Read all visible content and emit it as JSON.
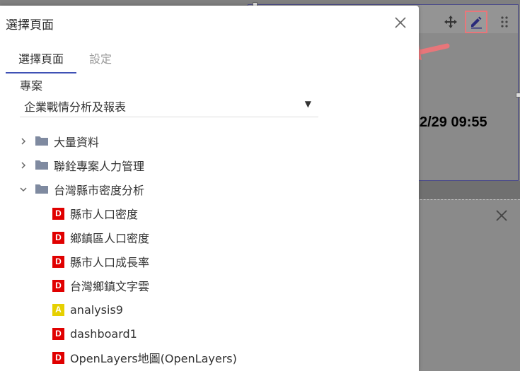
{
  "background": {
    "time_text": "2/29 09:55"
  },
  "dialog": {
    "title": "選擇頁面",
    "tabs": [
      {
        "label": "選擇頁面",
        "active": true
      },
      {
        "label": "設定",
        "active": false
      }
    ],
    "project_label": "專案",
    "project_value": "企業戰情分析及報表",
    "tree": [
      {
        "type": "folder",
        "label": "大量資料",
        "expanded": false
      },
      {
        "type": "folder",
        "label": "聯銓專案人力管理",
        "expanded": false
      },
      {
        "type": "folder",
        "label": "台灣縣市密度分析",
        "expanded": true
      },
      {
        "type": "page",
        "badge": "D",
        "label": "縣市人口密度"
      },
      {
        "type": "page",
        "badge": "D",
        "label": "鄉鎮區人口密度"
      },
      {
        "type": "page",
        "badge": "D",
        "label": "縣市人口成長率"
      },
      {
        "type": "page",
        "badge": "D",
        "label": "台灣鄉鎮文字雲"
      },
      {
        "type": "page",
        "badge": "A",
        "label": "analysis9"
      },
      {
        "type": "page",
        "badge": "D",
        "label": "dashboard1"
      },
      {
        "type": "page",
        "badge": "D",
        "label": "OpenLayers地圖(OpenLayers)"
      }
    ]
  },
  "colors": {
    "accent": "#3f51b5",
    "dashboard_badge": "#e00000",
    "analysis_badge": "#e6d000",
    "highlight": "#e8767a"
  }
}
